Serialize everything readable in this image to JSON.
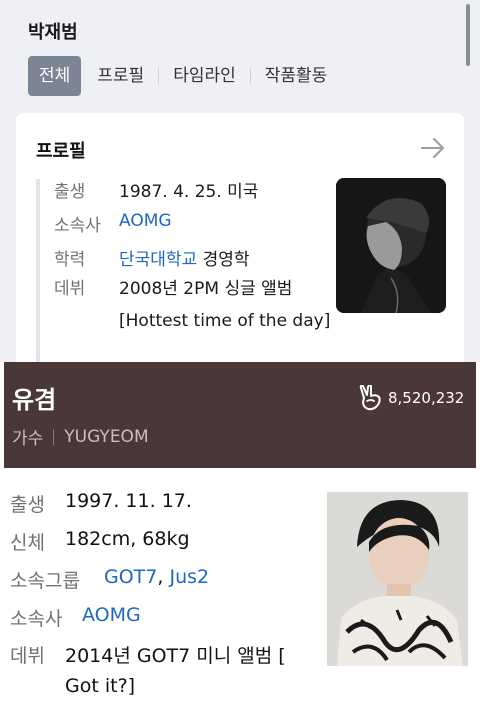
{
  "top": {
    "name": "박재범",
    "tabs": [
      {
        "label": "전체",
        "active": true
      },
      {
        "label": "프로필",
        "active": false
      },
      {
        "label": "타임라인",
        "active": false
      },
      {
        "label": "작품활동",
        "active": false
      }
    ],
    "card": {
      "title": "프로필",
      "arrow_icon": "arrow-right-icon",
      "rows": [
        {
          "label": "출생",
          "value": "1987. 4. 25. 미국"
        },
        {
          "label": "소속사",
          "value": "AOMG"
        },
        {
          "label": "학력",
          "link": "단국대학교",
          "value": " 경영학"
        },
        {
          "label": "데뷔",
          "value": "2008년 2PM 싱글 앨범 [Hottest time of the day]"
        }
      ]
    }
  },
  "banner": {
    "name": "유겸",
    "job": "가수",
    "english_name": "YUGYEOM",
    "cheer_icon": "v-hand-icon",
    "cheer_count": "8,520,232",
    "color": "#4a3838"
  },
  "bottom": {
    "rows": [
      {
        "label": "출생",
        "value": "1997. 11. 17."
      },
      {
        "label": "신체",
        "value": "182cm, 68kg"
      },
      {
        "label": "소속그룹",
        "links": [
          "GOT7",
          "Jus2"
        ],
        "separator": ", "
      },
      {
        "label": "소속사",
        "link": "AOMG"
      },
      {
        "label": "데뷔",
        "value": "2014년 GOT7 미니 앨범 [",
        "value2": "Got it?]"
      }
    ]
  },
  "colors": {
    "link": "#1f68c1",
    "active_tab": "#7c8594"
  }
}
